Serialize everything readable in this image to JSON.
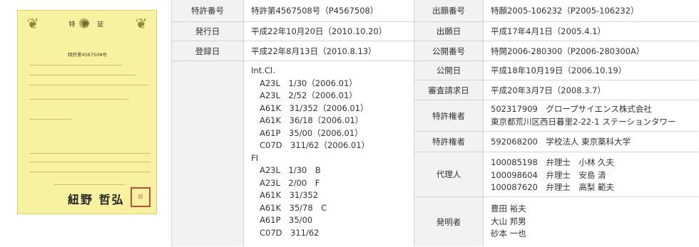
{
  "certificate": {
    "title": "特 許 証",
    "number": "特許第4567508号"
  },
  "left": [
    {
      "label": "特許番号",
      "value": "特許第4567508号（P4567508）"
    },
    {
      "label": "発行日",
      "value": "平成22年10月20日（2010.10.20）"
    },
    {
      "label": "登録日",
      "value": "平成22年8月13日（2010.8.13）"
    }
  ],
  "classification": {
    "intcl_title": "Int.Cl.",
    "intcl": [
      "A23L　1/30（2006.01）",
      "A23L　2/52（2006.01）",
      "A61K　31/352（2006.01）",
      "A61K　36/18（2006.01）",
      "A61P　35/00（2006.01）",
      "C07D　311/62（2006.01）"
    ],
    "fi_title": "FI",
    "fi": [
      "A23L　1/30　B",
      "A23L　2/00　F",
      "A61K　31/352",
      "A61K　35/78　C",
      "A61P　35/00",
      "C07D　311/62"
    ]
  },
  "right": {
    "app_no_label": "出願番号",
    "app_no": "特願2005-106232（P2005-106232）",
    "app_date_label": "出願日",
    "app_date": "平成17年4月1日（2005.4.1）",
    "pub_no_label": "公開番号",
    "pub_no": "特開2006-280300（P2006-280300A）",
    "pub_date_label": "公開日",
    "pub_date": "平成18年10月19日（2006.10.19）",
    "exam_label": "審査請求日",
    "exam_date": "平成20年3月7日（2008.3.7）",
    "holder1_label": "特許権者",
    "holder1_lines": [
      "502317909　グロープサイエンス株式会社",
      "東京都荒川区西日暮里2-22-1 ステーションタワー"
    ],
    "holder2_label": "特許権者",
    "holder2": "592068200　学校法人 東京薬科大学",
    "agent_label": "代理人",
    "agents": [
      "100085198　弁理士　小林 久夫",
      "100098604　弁理士　安島 清",
      "100087620　弁理士　高梨 範夫"
    ],
    "inventor_label": "発明者",
    "inventors": [
      "豊田 裕夫",
      "大山 邦男",
      "砂本 一也"
    ]
  }
}
